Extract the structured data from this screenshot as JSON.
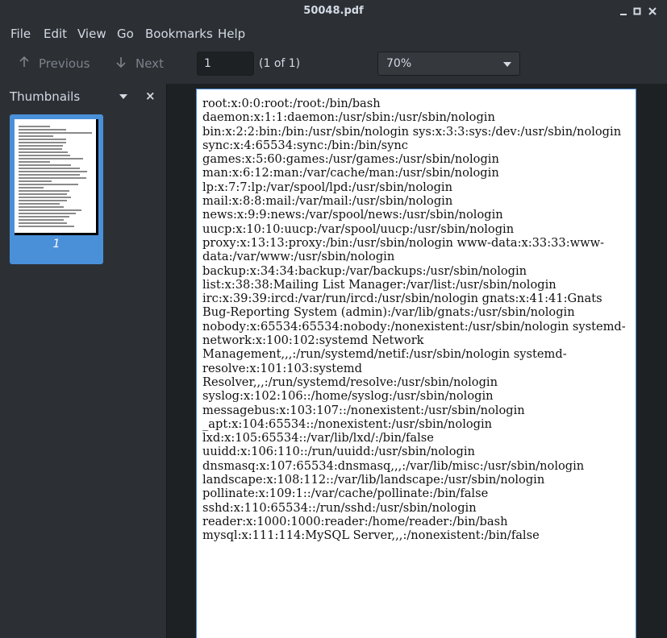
{
  "window": {
    "title": "50048.pdf",
    "minimize_icon": "minimize-icon",
    "maximize_icon": "maximize-icon",
    "close_icon": "close-icon"
  },
  "menu": [
    "File",
    "Edit",
    "View",
    "Go",
    "Bookmarks",
    "Help"
  ],
  "toolbar": {
    "previous_label": "Previous",
    "next_label": "Next",
    "page_value": "1",
    "page_count": "(1 of 1)",
    "zoom_value": "70%"
  },
  "sidebar": {
    "title": "Thumbnails",
    "thumbnail_number": "1"
  },
  "document": {
    "text": "root:x:0:0:root:/root:/bin/bash\ndaemon:x:1:1:daemon:/usr/sbin:/usr/sbin/nologin\nbin:x:2:2:bin:/bin:/usr/sbin/nologin sys:x:3:3:sys:/dev:/usr/sbin/nologin\nsync:x:4:65534:sync:/bin:/bin/sync\ngames:x:5:60:games:/usr/games:/usr/sbin/nologin\nman:x:6:12:man:/var/cache/man:/usr/sbin/nologin\nlp:x:7:7:lp:/var/spool/lpd:/usr/sbin/nologin\nmail:x:8:8:mail:/var/mail:/usr/sbin/nologin\nnews:x:9:9:news:/var/spool/news:/usr/sbin/nologin\nuucp:x:10:10:uucp:/var/spool/uucp:/usr/sbin/nologin\nproxy:x:13:13:proxy:/bin:/usr/sbin/nologin www-data:x:33:33:www-\ndata:/var/www:/usr/sbin/nologin\nbackup:x:34:34:backup:/var/backups:/usr/sbin/nologin\nlist:x:38:38:Mailing List Manager:/var/list:/usr/sbin/nologin\nirc:x:39:39:ircd:/var/run/ircd:/usr/sbin/nologin gnats:x:41:41:Gnats\nBug-Reporting System (admin):/var/lib/gnats:/usr/sbin/nologin\nnobody:x:65534:65534:nobody:/nonexistent:/usr/sbin/nologin systemd-\nnetwork:x:100:102:systemd Network\nManagement,,,:/run/systemd/netif:/usr/sbin/nologin systemd-\nresolve:x:101:103:systemd\nResolver,,,:/run/systemd/resolve:/usr/sbin/nologin\nsyslog:x:102:106::/home/syslog:/usr/sbin/nologin\nmessagebus:x:103:107::/nonexistent:/usr/sbin/nologin\n_apt:x:104:65534::/nonexistent:/usr/sbin/nologin\nlxd:x:105:65534::/var/lib/lxd/:/bin/false\nuuidd:x:106:110::/run/uuidd:/usr/sbin/nologin\ndnsmasq:x:107:65534:dnsmasq,,,:/var/lib/misc:/usr/sbin/nologin\nlandscape:x:108:112::/var/lib/landscape:/usr/sbin/nologin\npollinate:x:109:1::/var/cache/pollinate:/bin/false\nsshd:x:110:65534::/run/sshd:/usr/sbin/nologin\nreader:x:1000:1000:reader:/home/reader:/bin/bash\nmysql:x:111:114:MySQL Server,,,:/nonexistent:/bin/false"
  },
  "colors": {
    "accent": "#4a90d9",
    "chrome": "#2c3035",
    "background": "#1e2123"
  }
}
